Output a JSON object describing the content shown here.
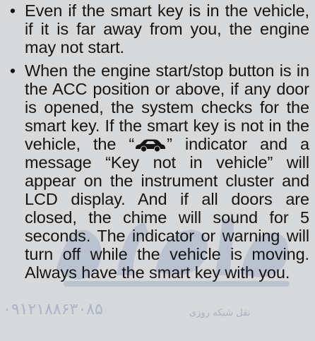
{
  "bullets": [
    {
      "text": "Even if the smart key is in the vehicle, if it is far away from you, the engine may not start."
    },
    {
      "before_icon": "When the engine start/stop button is in the ACC position or above, if any door is opened, the system checks for the smart key. If the smart key is not in the vehicle, the “",
      "icon": "car-key-warning-icon",
      "after_icon": "” indicator and a message “Key not in vehicle” will appear on the instrument cluster and  LCD display. And if all doors are closed, the chime will sound for 5 seconds. The indicator or warning will turn off while the vehicle is moving. Always have the smart key with you."
    }
  ],
  "bullet_symbol": "•",
  "watermark": {
    "caption": "نقل شبکه روزی",
    "digits": "۰۹۱۲۱۸۸۶۳۰۸۵",
    "color": "#2c4f9e"
  }
}
